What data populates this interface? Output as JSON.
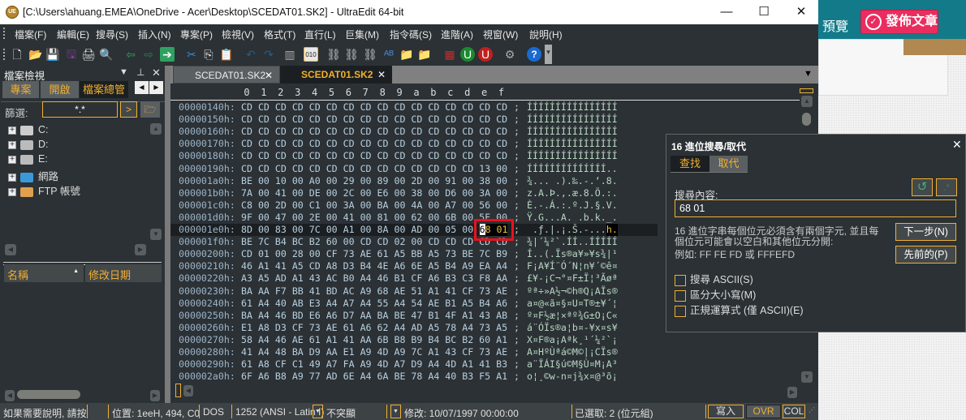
{
  "window": {
    "title": "[C:\\Users\\ahuang.EMEA\\OneDrive - Acer\\Desktop\\SCEDAT01.SK2] - UltraEdit 64-bit",
    "logo": "UE",
    "minimize": "—",
    "maximize": "☐",
    "close": "✕"
  },
  "menu": [
    "檔案(F)",
    "編輯(E)",
    "搜尋(S)",
    "插入(N)",
    "專案(P)",
    "檢視(V)",
    "格式(T)",
    "直行(L)",
    "巨集(M)",
    "指令碼(S)",
    "進階(A)",
    "視窗(W)",
    "說明(H)"
  ],
  "toolbar": [
    "new-file",
    "open",
    "save",
    "save-as",
    "print",
    "print-preview",
    "back",
    "forward",
    "go",
    "cut",
    "copy",
    "paste",
    "undo",
    "redo",
    "column-mode",
    "hex-mode",
    "find",
    "find-prev",
    "find-next",
    "replace",
    "find-in-files",
    "replace-in-files",
    "macro",
    "uf",
    "uh",
    "settings",
    "help"
  ],
  "left_panel": {
    "title": "檔案檢視",
    "tabs": [
      "專案",
      "開啟",
      "檔案總管"
    ],
    "active_tab": 2,
    "filter_label": "篩選:",
    "filter_value": "*.*",
    "go_label": ">",
    "tree": [
      "C:",
      "D:",
      "E:",
      "網路",
      "FTP 帳號"
    ],
    "columns": [
      "名稱",
      "修改日期"
    ]
  },
  "editor": {
    "tabs": [
      "SCEDAT01.SK2",
      "SCEDAT01.SK2"
    ],
    "active_tab": 1,
    "ruler": [
      "0",
      "1",
      "2",
      "3",
      "4",
      "5",
      "6",
      "7",
      "8",
      "9",
      "a",
      "b",
      "c",
      "d",
      "e",
      "f"
    ],
    "rows": [
      {
        "addr": "00000140h:",
        "hex": "CD CD CD CD CD CD CD CD CD CD CD CD CD CD CD CD",
        "ascii": "ÍÍÍÍÍÍÍÍÍÍÍÍÍÍÍÍ"
      },
      {
        "addr": "00000150h:",
        "hex": "CD CD CD CD CD CD CD CD CD CD CD CD CD CD CD CD",
        "ascii": "ÍÍÍÍÍÍÍÍÍÍÍÍÍÍÍÍ"
      },
      {
        "addr": "00000160h:",
        "hex": "CD CD CD CD CD CD CD CD CD CD CD CD CD CD CD CD",
        "ascii": "ÍÍÍÍÍÍÍÍÍÍÍÍÍÍÍÍ"
      },
      {
        "addr": "00000170h:",
        "hex": "CD CD CD CD CD CD CD CD CD CD CD CD CD CD CD CD",
        "ascii": "ÍÍÍÍÍÍÍÍÍÍÍÍÍÍÍÍ"
      },
      {
        "addr": "00000180h:",
        "hex": "CD CD CD CD CD CD CD CD CD CD CD CD CD CD CD CD",
        "ascii": "ÍÍÍÍÍÍÍÍÍÍÍÍÍÍÍÍ"
      },
      {
        "addr": "00000190h:",
        "hex": "CD CD CD CD CD CD CD CD CD CD CD CD CD CD 13 00",
        "ascii": "ÍÍÍÍÍÍÍÍÍÍÍÍÍÍ.."
      },
      {
        "addr": "000001a0h:",
        "hex": "BE 00 10 00 A0 00 29 00 89 00 2D 00 91 00 38 00",
        "ascii": "¾... .).‰.-.‘.8."
      },
      {
        "addr": "000001b0h:",
        "hex": "7A 00 41 00 DE 00 2C 00 E6 00 38 00 D6 00 3A 00",
        "ascii": "z.A.Þ.,.æ.8.Ö.:."
      },
      {
        "addr": "000001c0h:",
        "hex": "C8 00 2D 00 C1 00 3A 00 BA 00 4A 00 A7 00 56 00",
        "ascii": "È.-.Á.:.º.J.§.V."
      },
      {
        "addr": "000001d0h:",
        "hex": "9F 00 47 00 2E 00 41 00 81 00 62 00 6B 00 5F 00",
        "ascii": "Ÿ.G...A. .b.k._."
      },
      {
        "addr": "000001e0h:",
        "hex": "8D 00 83 00 7C 00 A1 00 8A 00 AD 00 05 00 68 01",
        "ascii": " .ƒ.|.¡.Š.-...h."
      },
      {
        "addr": "000001f0h:",
        "hex": "BE 7C B4 BC B2 60 00 CD CD 02 00 CD CD CD CD CD",
        "ascii": "¾|´¼²`.ÍÍ..ÍÍÍÍÍ"
      },
      {
        "addr": "00000200h:",
        "hex": "CD 01 00 28 00 CF 73 AE 61 A5 BB A5 73 BE 7C B9",
        "ascii": "Í..(.Ïs®a¥»¥s¾|¹"
      },
      {
        "addr": "00000210h:",
        "hex": "46 A1 41 A5 CD A8 D3 B4 4E A6 6E A5 B4 A9 EA A4",
        "ascii": "F¡A¥Í¨Ó´N¦n¥´©ê¤"
      },
      {
        "addr": "00000220h:",
        "hex": "A3 A5 AD A1 43 AC B0 A4 46 B1 CF A6 B3 C3 F8 AA",
        "ascii": "£¥-¡C¬°¤F±Ï¦³Ãøª"
      },
      {
        "addr": "00000230h:",
        "hex": "BA AA F7 BB 41 BD AC A9 68 AE 51 A1 41 CF 73 AE",
        "ascii": "ºª÷»A½¬©h®Q¡AÏs®"
      },
      {
        "addr": "00000240h:",
        "hex": "61 A4 40 AB E3 A4 A7 A4 55 A4 54 AE B1 A5 B4 A6",
        "ascii": "a¤@«ã¤§¤U¤T®±¥´¦"
      },
      {
        "addr": "00000250h:",
        "hex": "BA A4 46 BD E6 A6 D7 AA BA BE 47 B1 4F A1 43 AB",
        "ascii": "º¤F½æ¦×ªº¾G±O¡C«"
      },
      {
        "addr": "00000260h:",
        "hex": "E1 A8 D3 CF 73 AE 61 A6 62 A4 AD A5 78 A4 73 A5",
        "ascii": "á¨ÓÏs®a¦b¤-¥x¤s¥"
      },
      {
        "addr": "00000270h:",
        "hex": "58 A4 46 AE 61 A1 41 AA 6B B8 B9 B4 BC B2 60 A1",
        "ascii": "X¤F®a¡Aªk¸¹´¼²`¡"
      },
      {
        "addr": "00000280h:",
        "hex": "41 A4 48 BA D9 AA E1 A9 4D A9 7C A1 43 CF 73 AE",
        "ascii": "A¤HºÙªá©M©|¡CÏs®"
      },
      {
        "addr": "00000290h:",
        "hex": "61 A8 CF C1 49 A7 FA A9 4D A7 D9 A4 4D A1 41 B3",
        "ascii": "a¨ÏÁI§ú©M§Ù¤M¡A³"
      },
      {
        "addr": "000002a0h:",
        "hex": "6F A6 B8 A9 77 AD 6E A4 6A BE 78 A4 40 B3 F5 A1",
        "ascii": "o¦¸©w-n¤j¾x¤@³õ¡"
      }
    ],
    "current_row": 10,
    "selection_hex": "68 01",
    "selection_ascii": "h."
  },
  "dialog": {
    "title": "16 進位搜尋/取代",
    "tabs": [
      "查找",
      "取代"
    ],
    "active_tab": 0,
    "search_label": "搜尋內容:",
    "search_value": "68 01",
    "hint": "16 進位字串每個位元必須含有兩個字元, 並且每個位元可能會以空白和其他位元分開:",
    "example": "例如: FF FE FD 或 FFFEFD",
    "next_button": "下一步(N)",
    "prev_button": "先前的(P)",
    "options": [
      {
        "label": "搜尋 ASCII(S)",
        "checked": false
      },
      {
        "label": "區分大小寫(M)",
        "checked": false
      },
      {
        "label": "正規運算式 (僅 ASCII)(E)",
        "checked": false
      }
    ]
  },
  "statusbar": {
    "help": "如果需要說明, 請按",
    "position": "位置: 1eeH, 494, C0",
    "line_ending": "DOS",
    "encoding": "1252  (ANSI - Latin I)",
    "highlight": "不突顯",
    "modified": "修改: 10/07/1997 00:00:00",
    "selected": "已選取: 2 (位元組)",
    "write": "寫入",
    "ovr": "OVR",
    "col": "COL"
  },
  "browser": {
    "preview": "預覽",
    "publish": "發佈文章"
  },
  "colors": {
    "accent": "#f0b030",
    "background": "#2b3135",
    "selection_box": "#e8121c",
    "publish": "#ea2d5f",
    "browser_header": "#137a8a"
  }
}
